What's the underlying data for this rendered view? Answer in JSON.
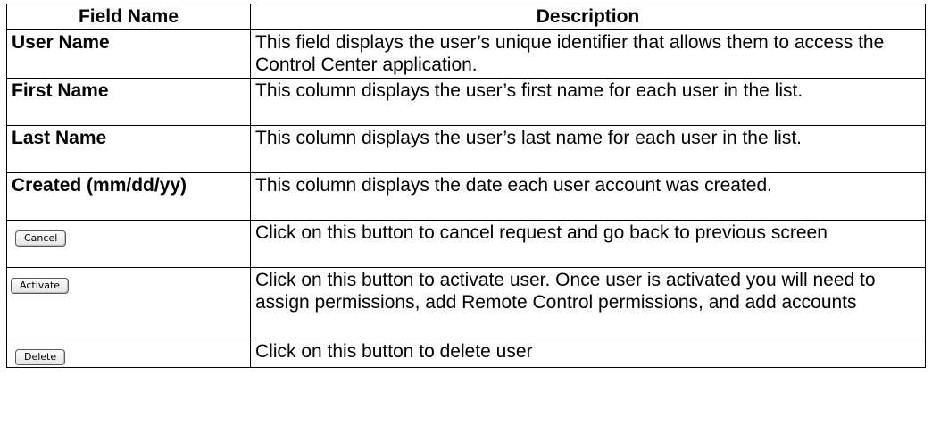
{
  "table": {
    "headers": [
      "Field Name",
      "Description"
    ],
    "rows": [
      {
        "field": "User Name",
        "description": "This field displays the user’s unique identifier that allows them to access the Control Center application."
      },
      {
        "field": "First Name",
        "description": "This column displays the user’s first name for each user in the list."
      },
      {
        "field": "Last Name",
        "description": "This column displays the user’s last name for each user in the list."
      },
      {
        "field": "Created (mm/dd/yy)",
        "description": "This column displays the date each user account was created."
      },
      {
        "button_label": "Cancel",
        "description": "Click on this button to cancel request and go back to previous screen"
      },
      {
        "button_label": "Activate",
        "description": "Click on this button to activate user.  Once user is activated you will need to assign permissions, add Remote Control permissions, and add accounts"
      },
      {
        "button_label": "Delete",
        "description": "Click on this button to delete user"
      }
    ]
  }
}
